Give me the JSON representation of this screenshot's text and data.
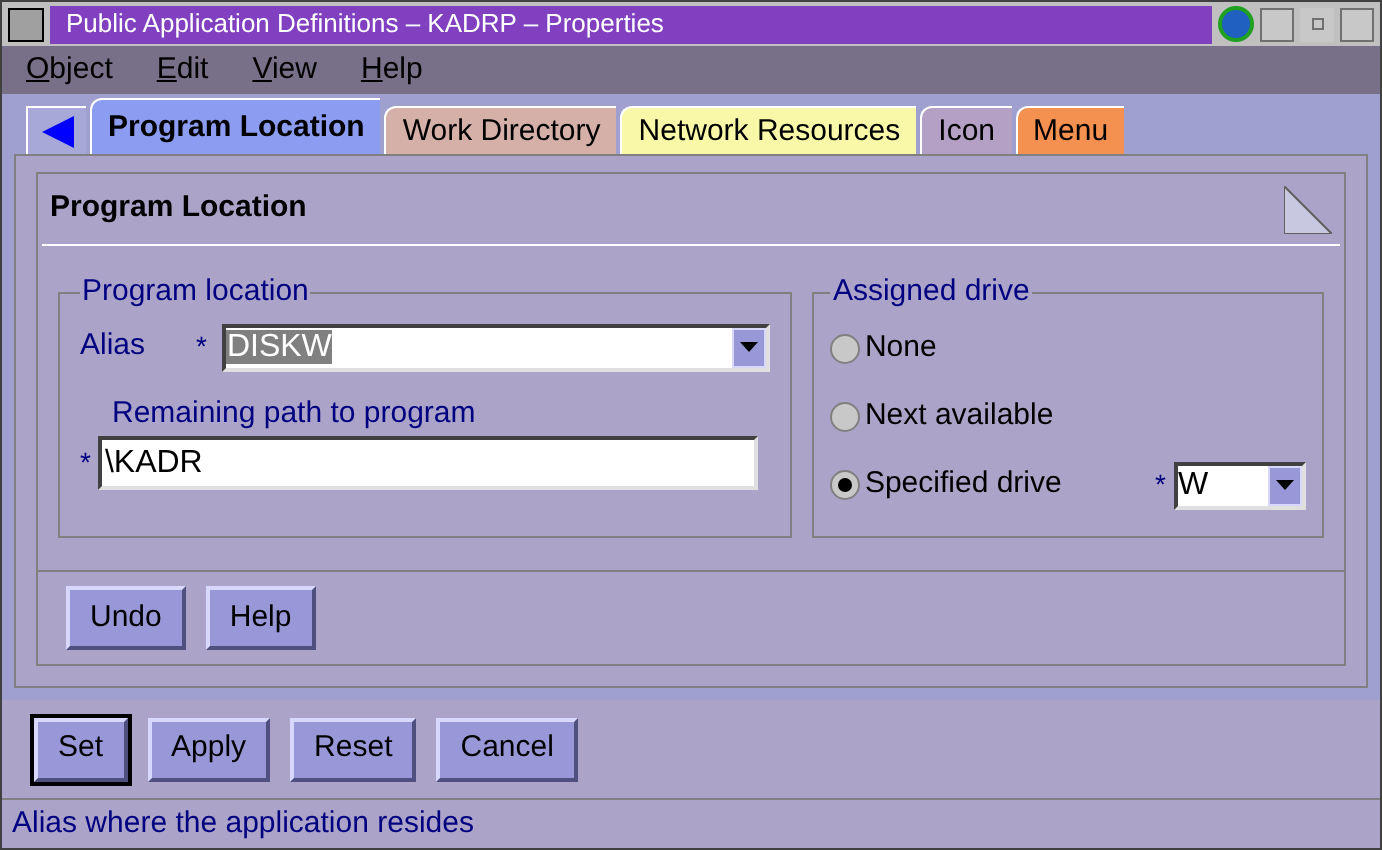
{
  "window": {
    "title": "Public Application Definitions – KADRP – Properties"
  },
  "menu": [
    "Object",
    "Edit",
    "View",
    "Help"
  ],
  "tabs": [
    {
      "label": "Program Location",
      "selected": true,
      "color": "#8c9cf0"
    },
    {
      "label": "Work Directory",
      "selected": false,
      "color": "#d4b0a8"
    },
    {
      "label": "Network Resources",
      "selected": false,
      "color": "#f8f8a8"
    },
    {
      "label": "Icon",
      "selected": false,
      "color": "#b4a0c4"
    },
    {
      "label": "Menu",
      "selected": false,
      "color": "#f49050"
    }
  ],
  "page": {
    "title": "Program Location",
    "program_location": {
      "legend": "Program location",
      "alias_label": "Alias",
      "alias_required": "*",
      "alias_value": "DISKW",
      "path_label": "Remaining path to program",
      "path_required": "*",
      "path_value": "\\KADR"
    },
    "assigned_drive": {
      "legend": "Assigned drive",
      "options": [
        {
          "label": "None",
          "selected": false
        },
        {
          "label": "Next available",
          "selected": false
        },
        {
          "label": "Specified drive",
          "selected": true
        }
      ],
      "drive_required": "*",
      "drive_value": "W"
    },
    "buttons": [
      "Undo",
      "Help"
    ]
  },
  "buttons": [
    {
      "label": "Set",
      "default": true
    },
    {
      "label": "Apply",
      "default": false
    },
    {
      "label": "Reset",
      "default": false
    },
    {
      "label": "Cancel",
      "default": false
    }
  ],
  "status_bar": "Alias where the application resides"
}
